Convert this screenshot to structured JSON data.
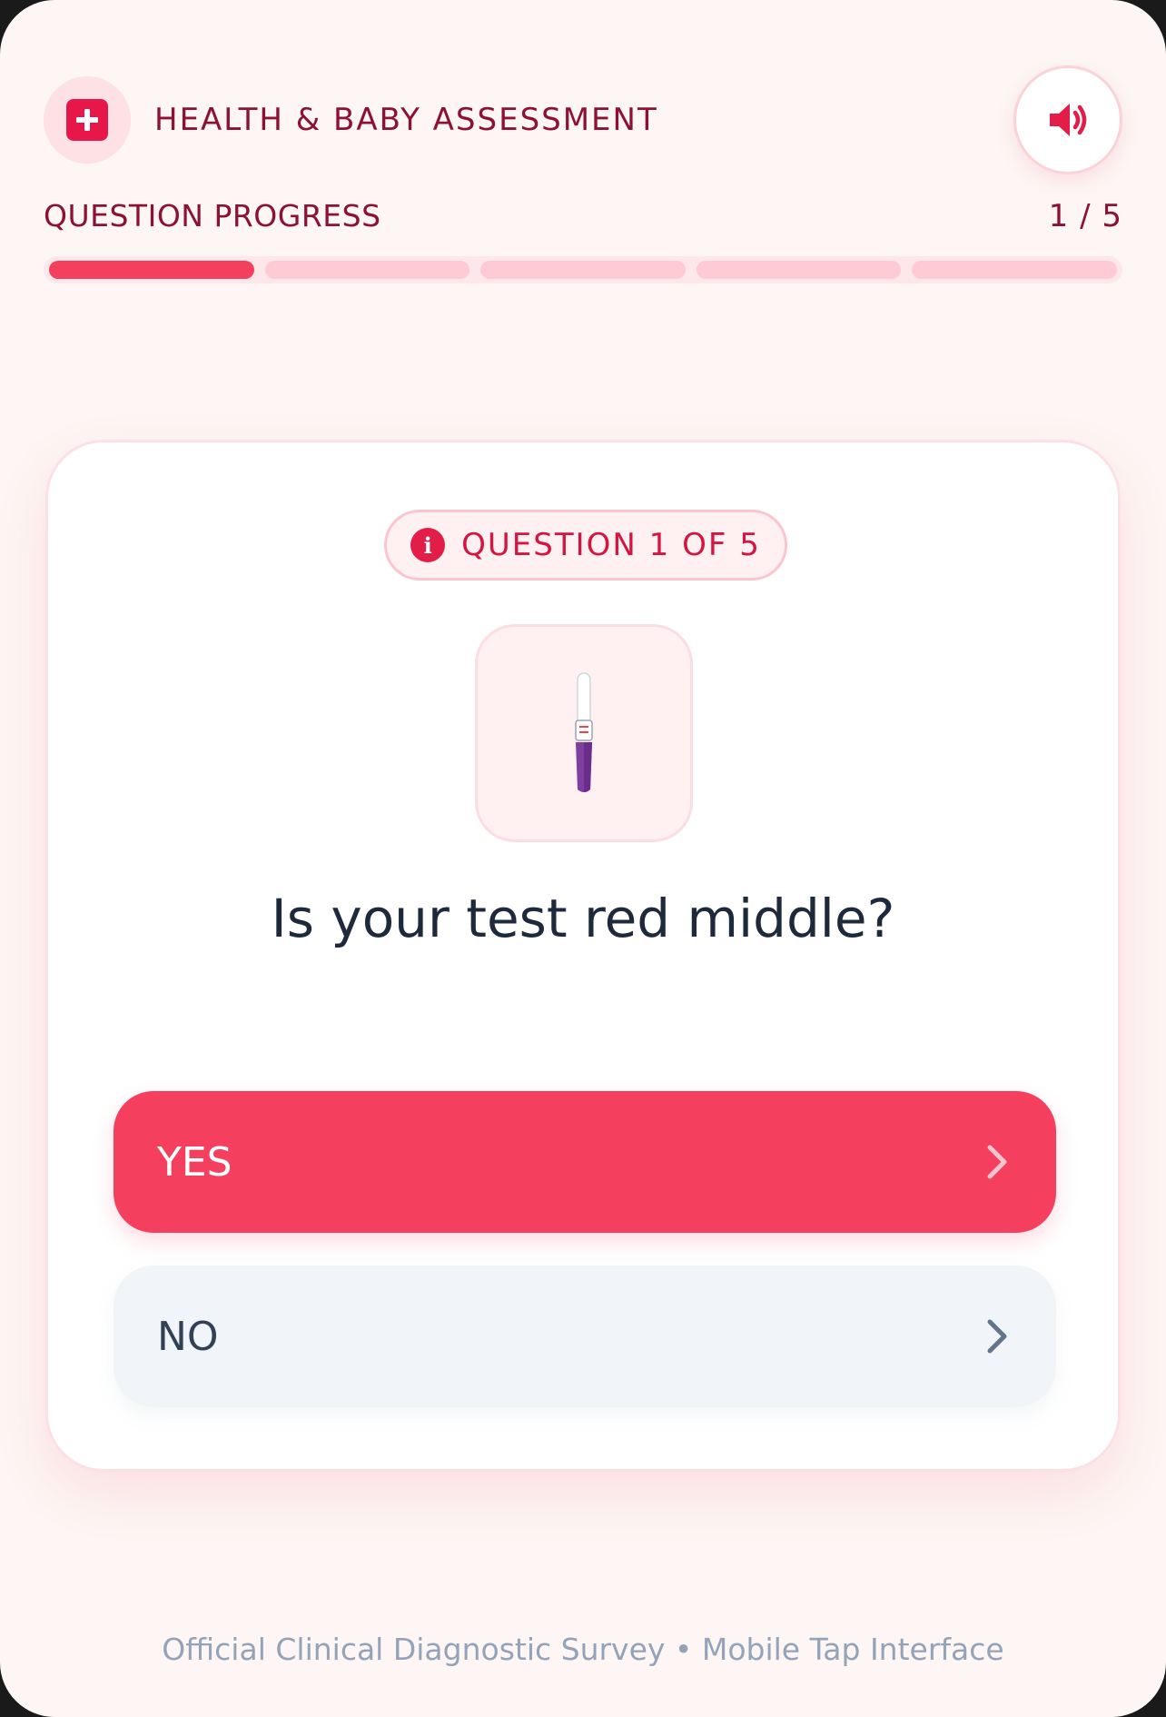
{
  "header": {
    "logo_icon": "medical-cross-icon",
    "title": "HEALTH & BABY ASSESSMENT",
    "sound_icon": "speaker-icon"
  },
  "progress": {
    "label": "QUESTION PROGRESS",
    "count": "1 / 5",
    "current": 1,
    "total": 5
  },
  "card": {
    "badge_icon": "info-icon",
    "badge_text": "QUESTION 1 OF 5",
    "illustration": "pregnancy-test-icon",
    "question": "Is your test red middle?",
    "answers": [
      {
        "label": "YES",
        "icon": "chevron-right-icon",
        "selected": true
      },
      {
        "label": "NO",
        "icon": "chevron-right-icon",
        "selected": false
      }
    ]
  },
  "footer": {
    "text": "Official Clinical Diagnostic Survey • Mobile Tap Interface"
  },
  "colors": {
    "accent": "#f43f5e",
    "brand_dark": "#8b1235",
    "background": "#fdf6f4",
    "segment_inactive": "#fecad4"
  }
}
